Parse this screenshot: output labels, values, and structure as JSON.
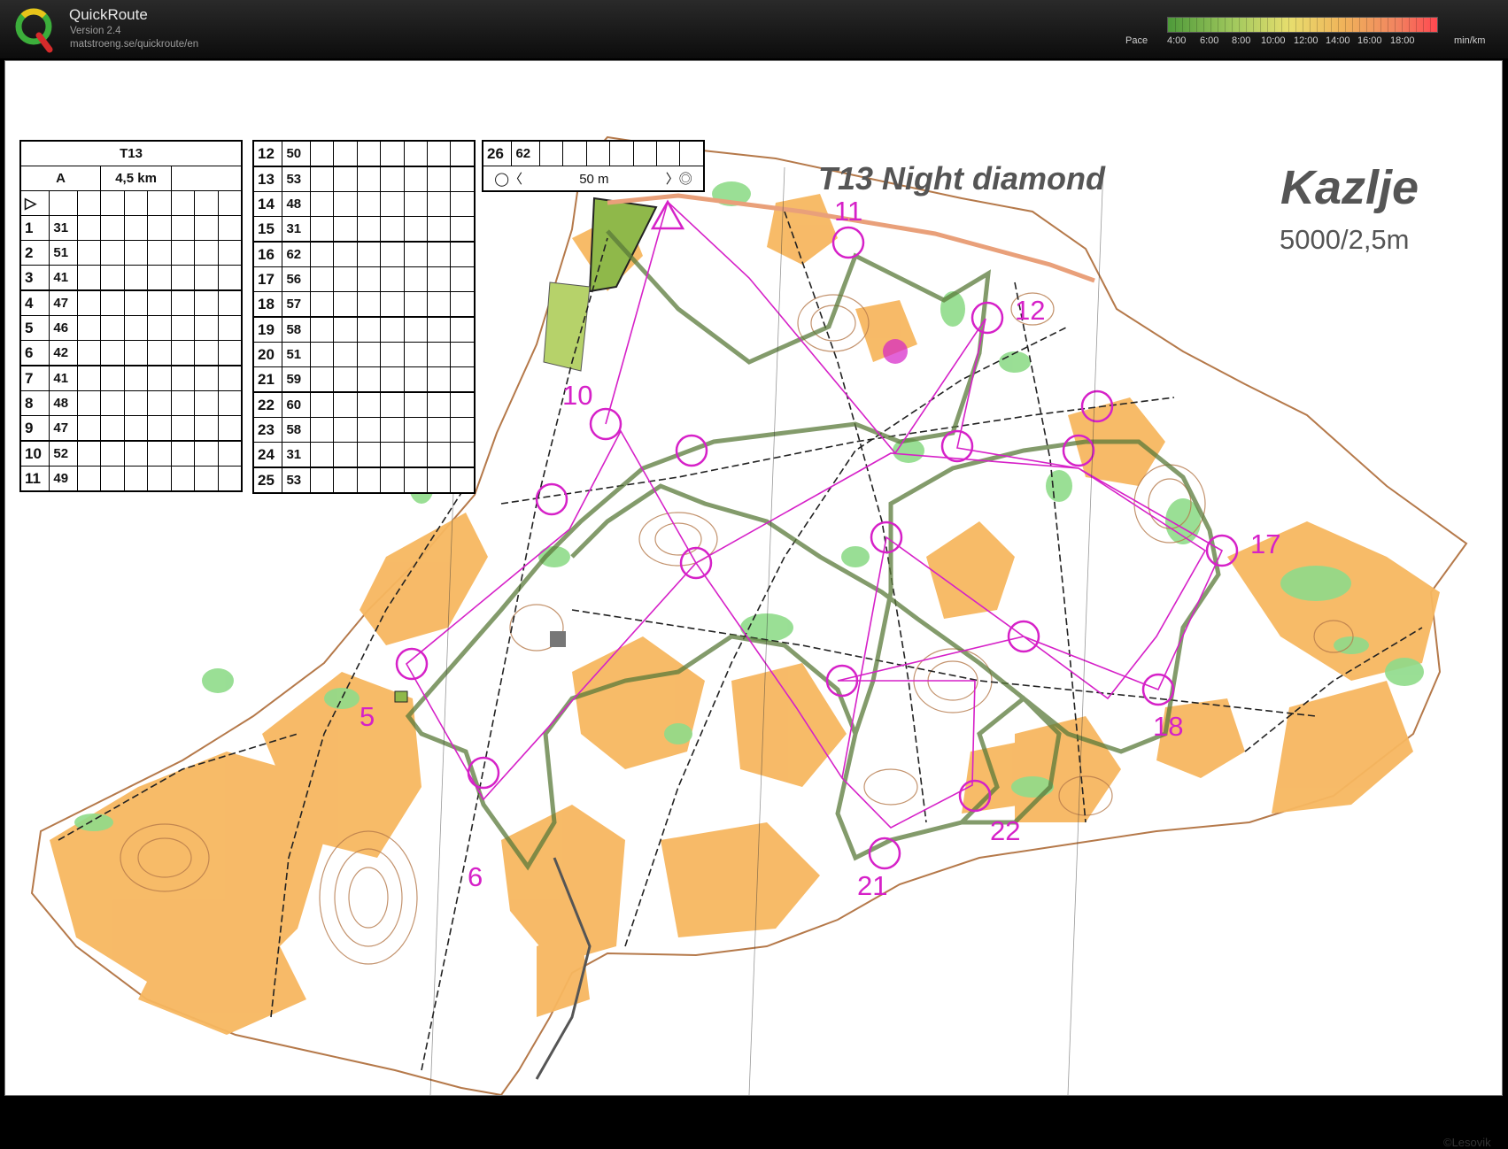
{
  "app": {
    "title": "QuickRoute",
    "version": "Version 2.4",
    "url": "matstroeng.se/quickroute/en",
    "logo_letter": "Q"
  },
  "pace": {
    "label": "Pace",
    "ticks": [
      "4:00",
      "6:00",
      "8:00",
      "10:00",
      "12:00",
      "14:00",
      "16:00",
      "18:00"
    ],
    "unit": "min/km",
    "colors": [
      "#4e9a3a",
      "#a3c95e",
      "#e7de6e",
      "#f0b35a",
      "#f18460",
      "#ff4850"
    ]
  },
  "map": {
    "course_title": "T13 Night diamond",
    "map_name": "Kazlje",
    "scale": "5000/2,5m",
    "copyright": "©Lesovik",
    "colors": {
      "open_land": "#f7b760",
      "green": "#8fdb8a",
      "contour": "#b5794a",
      "course": "#d621c8",
      "route": "#5a7a3a",
      "track": "#222222"
    },
    "control_labels": [
      {
        "id": "5",
        "text": "5"
      },
      {
        "id": "6",
        "text": "6"
      },
      {
        "id": "10",
        "text": "10"
      },
      {
        "id": "11",
        "text": "11"
      },
      {
        "id": "12",
        "text": "12"
      },
      {
        "id": "17",
        "text": "17"
      },
      {
        "id": "18",
        "text": "18"
      },
      {
        "id": "21",
        "text": "21"
      },
      {
        "id": "22",
        "text": "22"
      }
    ]
  },
  "card": {
    "title": "T13",
    "class": "A",
    "length": "4,5 km",
    "start_symbol": "▷",
    "leg_distance": "50 m",
    "controls": [
      {
        "num": "1",
        "code": "31"
      },
      {
        "num": "2",
        "code": "51"
      },
      {
        "num": "3",
        "code": "41"
      },
      {
        "num": "4",
        "code": "47"
      },
      {
        "num": "5",
        "code": "46"
      },
      {
        "num": "6",
        "code": "42"
      },
      {
        "num": "7",
        "code": "41"
      },
      {
        "num": "8",
        "code": "48"
      },
      {
        "num": "9",
        "code": "47"
      },
      {
        "num": "10",
        "code": "52"
      },
      {
        "num": "11",
        "code": "49"
      },
      {
        "num": "12",
        "code": "50"
      },
      {
        "num": "13",
        "code": "53"
      },
      {
        "num": "14",
        "code": "48"
      },
      {
        "num": "15",
        "code": "31"
      },
      {
        "num": "16",
        "code": "62"
      },
      {
        "num": "17",
        "code": "56"
      },
      {
        "num": "18",
        "code": "57"
      },
      {
        "num": "19",
        "code": "58"
      },
      {
        "num": "20",
        "code": "51"
      },
      {
        "num": "21",
        "code": "59"
      },
      {
        "num": "22",
        "code": "60"
      },
      {
        "num": "23",
        "code": "58"
      },
      {
        "num": "24",
        "code": "31"
      },
      {
        "num": "25",
        "code": "53"
      },
      {
        "num": "26",
        "code": "62"
      }
    ]
  }
}
